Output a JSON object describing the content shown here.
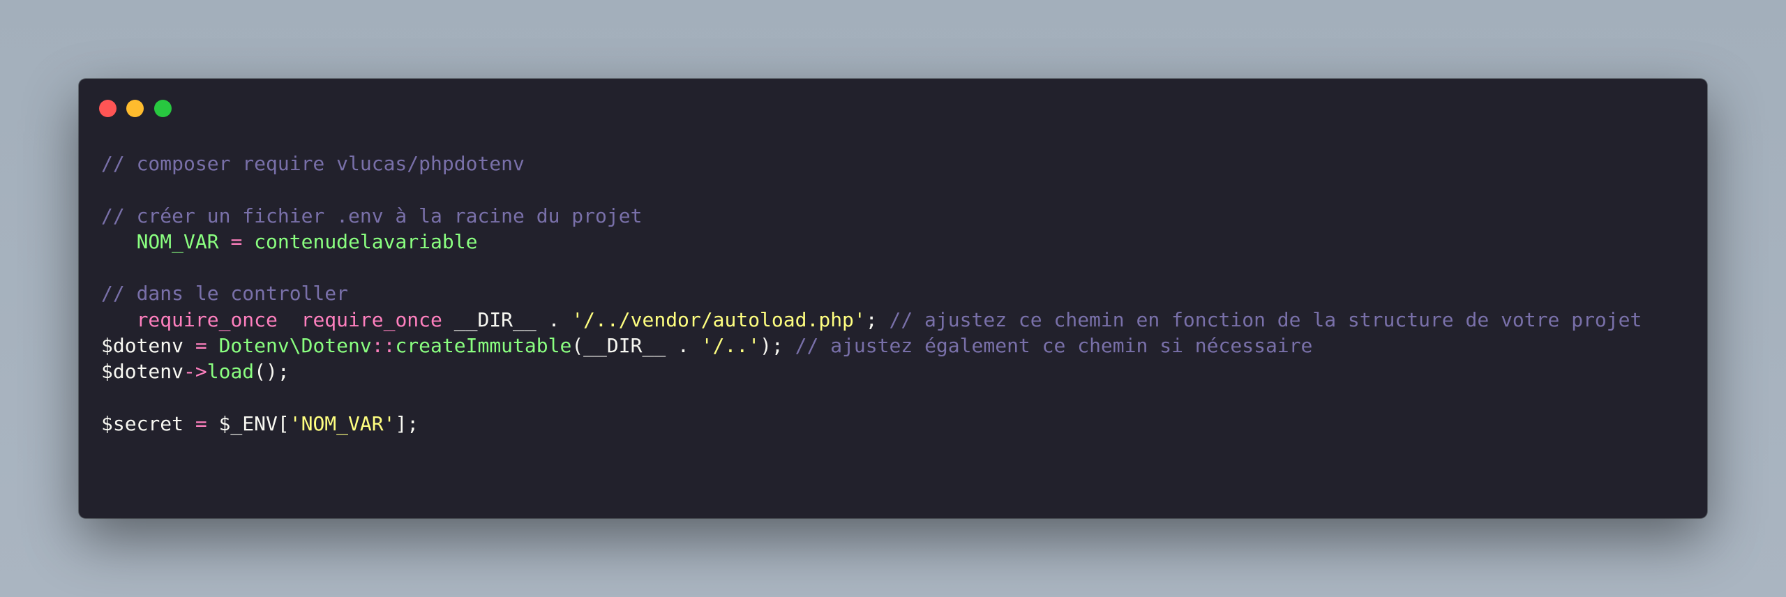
{
  "window": {
    "controls": [
      {
        "name": "close",
        "color": "#ff5555"
      },
      {
        "name": "minimize",
        "color": "#ffbc2e"
      },
      {
        "name": "zoom",
        "color": "#28c840"
      }
    ]
  },
  "colors": {
    "background": "#22212c",
    "comment": "#7970a9",
    "keyword": "#ff80bf",
    "function": "#8aff80",
    "string": "#ffff80",
    "plain": "#f8f8f2"
  },
  "code": {
    "lines": [
      [
        {
          "type": "comment",
          "text": "// composer require vlucas/phpdotenv"
        }
      ],
      [],
      [
        {
          "type": "comment",
          "text": "// créer un fichier .env à la racine du projet"
        }
      ],
      [
        {
          "type": "plain",
          "text": "   "
        },
        {
          "type": "func",
          "text": "NOM_VAR"
        },
        {
          "type": "plain",
          "text": " "
        },
        {
          "type": "keyword",
          "text": "="
        },
        {
          "type": "plain",
          "text": " "
        },
        {
          "type": "func",
          "text": "contenudelavariable"
        }
      ],
      [],
      [
        {
          "type": "comment",
          "text": "// dans le controller"
        }
      ],
      [
        {
          "type": "plain",
          "text": "   "
        },
        {
          "type": "keyword",
          "text": "require_once"
        },
        {
          "type": "plain",
          "text": "  "
        },
        {
          "type": "keyword",
          "text": "require_once"
        },
        {
          "type": "plain",
          "text": " __DIR__ . "
        },
        {
          "type": "string",
          "text": "'/../vendor/autoload.php'"
        },
        {
          "type": "plain",
          "text": "; "
        },
        {
          "type": "comment",
          "text": "// ajustez ce chemin en fonction de la structure de votre projet"
        }
      ],
      [
        {
          "type": "plain",
          "text": "$dotenv "
        },
        {
          "type": "keyword",
          "text": "="
        },
        {
          "type": "plain",
          "text": " "
        },
        {
          "type": "func",
          "text": "Dotenv\\Dotenv"
        },
        {
          "type": "keyword",
          "text": "::"
        },
        {
          "type": "func",
          "text": "createImmutable"
        },
        {
          "type": "plain",
          "text": "(__DIR__ . "
        },
        {
          "type": "string",
          "text": "'/..'"
        },
        {
          "type": "plain",
          "text": "); "
        },
        {
          "type": "comment",
          "text": "// ajustez également ce chemin si nécessaire"
        }
      ],
      [
        {
          "type": "plain",
          "text": "$dotenv"
        },
        {
          "type": "keyword",
          "text": "->"
        },
        {
          "type": "func",
          "text": "load"
        },
        {
          "type": "plain",
          "text": "();"
        }
      ],
      [],
      [
        {
          "type": "plain",
          "text": "$secret "
        },
        {
          "type": "keyword",
          "text": "="
        },
        {
          "type": "plain",
          "text": " $_ENV["
        },
        {
          "type": "string",
          "text": "'NOM_VAR'"
        },
        {
          "type": "plain",
          "text": "];"
        }
      ]
    ]
  }
}
